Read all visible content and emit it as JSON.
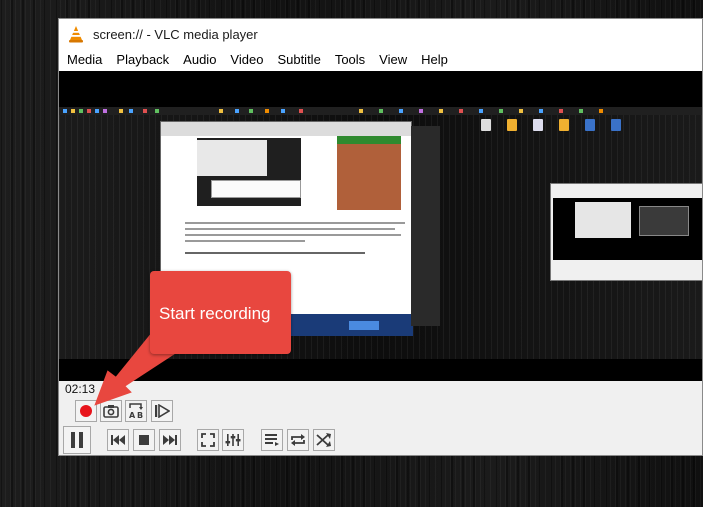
{
  "window": {
    "title": "screen:// - VLC media player"
  },
  "menubar": {
    "items": [
      "Media",
      "Playback",
      "Audio",
      "Video",
      "Subtitle",
      "Tools",
      "View",
      "Help"
    ]
  },
  "callout": {
    "text": "Start recording",
    "color": "#e8473f"
  },
  "player": {
    "elapsed_time": "02:13"
  },
  "advanced_controls": [
    {
      "name": "record-button",
      "icon": "record-icon"
    },
    {
      "name": "snapshot-button",
      "icon": "camera-icon"
    },
    {
      "name": "loop-ab-button",
      "icon": "loop-ab-icon"
    },
    {
      "name": "frame-by-frame-button",
      "icon": "frame-step-icon"
    }
  ],
  "main_controls": [
    {
      "name": "pause-button",
      "icon": "pause-icon"
    },
    {
      "name": "previous-button",
      "icon": "skip-back-icon"
    },
    {
      "name": "stop-button",
      "icon": "stop-icon"
    },
    {
      "name": "next-button",
      "icon": "skip-forward-icon"
    },
    {
      "name": "fullscreen-button",
      "icon": "fullscreen-icon"
    },
    {
      "name": "extended-settings-button",
      "icon": "equalizer-icon"
    },
    {
      "name": "playlist-button",
      "icon": "playlist-icon"
    },
    {
      "name": "loop-button",
      "icon": "repeat-icon"
    },
    {
      "name": "shuffle-button",
      "icon": "shuffle-icon"
    }
  ],
  "colors": {
    "record_red": "#e8141b",
    "icon_gray": "#3c3c3c",
    "vlc_orange": "#f08c00"
  }
}
